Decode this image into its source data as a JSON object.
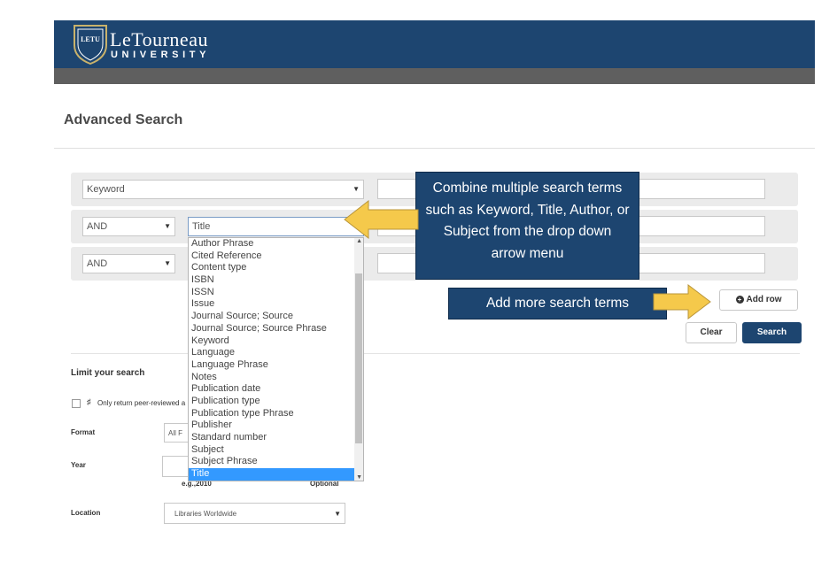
{
  "header": {
    "logo_badge": "LETU",
    "brand_name": "LeTourneau",
    "brand_sub": "UNIVERSITY"
  },
  "page_title": "Advanced Search",
  "search_rows": [
    {
      "field": "Keyword"
    },
    {
      "operator": "AND",
      "field": "Title"
    },
    {
      "operator": "AND"
    }
  ],
  "field_options": [
    "Author Phrase",
    "Cited Reference",
    "Content type",
    "ISBN",
    "ISSN",
    "Issue",
    "Journal Source; Source",
    "Journal Source; Source Phrase",
    "Keyword",
    "Language",
    "Language Phrase",
    "Notes",
    "Publication date",
    "Publication type",
    "Publication type Phrase",
    "Publisher",
    "Standard number",
    "Subject",
    "Subject Phrase",
    "Title"
  ],
  "selected_option": "Title",
  "callouts": {
    "combine": "Combine multiple search terms such as Keyword, Title, Author, or Subject from the drop down arrow menu",
    "add_more": "Add more search terms"
  },
  "buttons": {
    "add_row": "Add row",
    "clear": "Clear",
    "search": "Search"
  },
  "limit": {
    "heading": "Limit your search",
    "peer_reviewed": "Only return peer-reviewed a",
    "format_label": "Format",
    "format_value": "All F",
    "year_label": "Year",
    "year_hint": "e.g.,2010",
    "year_optional": "Optional",
    "location_label": "Location",
    "location_value": "Libraries Worldwide"
  },
  "colors": {
    "brand_blue": "#1d4570",
    "arrow_yellow": "#f5c94b",
    "selection_blue": "#3399ff"
  }
}
